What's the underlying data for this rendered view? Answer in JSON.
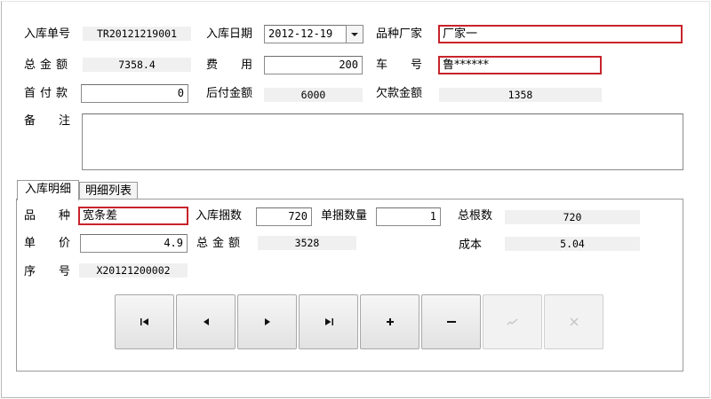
{
  "form": {
    "inbound_no": {
      "label": "入库单号",
      "value": "TR20121219001"
    },
    "inbound_date": {
      "label": "入库日期",
      "value": "2012-12-19"
    },
    "manufacturer": {
      "label": "品种厂家",
      "value": "厂家一"
    },
    "total_amount": {
      "label": "总金额",
      "value": "7358.4"
    },
    "fee": {
      "label": "费用",
      "value": "200"
    },
    "vehicle_no": {
      "label": "车号",
      "value": "鲁******"
    },
    "down_payment": {
      "label": "首付款",
      "value": "0"
    },
    "balance_payment": {
      "label": "后付金额",
      "value": "6000"
    },
    "arrears": {
      "label": "欠款金额",
      "value": "1358"
    },
    "remark": {
      "label": "备注",
      "value": ""
    }
  },
  "tabs": [
    {
      "label": "入库明细",
      "active": true
    },
    {
      "label": "明细列表",
      "active": false
    }
  ],
  "detail": {
    "variety": {
      "label": "品种",
      "value": "宽条差"
    },
    "bundles": {
      "label": "入库捆数",
      "value": "720"
    },
    "per_bundle": {
      "label": "单捆数量",
      "value": "1"
    },
    "total_roots": {
      "label": "总根数",
      "value": "720"
    },
    "unit_price": {
      "label": "单价",
      "value": "4.9"
    },
    "total_amount": {
      "label": "总金额",
      "value": "3528"
    },
    "cost": {
      "label": "成本",
      "value": "5.04"
    },
    "serial_no": {
      "label": "序号",
      "value": "X20121200002"
    }
  },
  "navigator": [
    {
      "name": "first-record-button",
      "icon": "first-icon",
      "glyph": "|◂",
      "enabled": true
    },
    {
      "name": "prior-record-button",
      "icon": "prior-icon",
      "glyph": "◂",
      "enabled": true
    },
    {
      "name": "next-record-button",
      "icon": "next-icon",
      "glyph": "▸",
      "enabled": true
    },
    {
      "name": "last-record-button",
      "icon": "last-icon",
      "glyph": "▸|",
      "enabled": true
    },
    {
      "name": "insert-record-button",
      "icon": "plus-icon",
      "glyph": "+",
      "enabled": true
    },
    {
      "name": "delete-record-button",
      "icon": "minus-icon",
      "glyph": "−",
      "enabled": true
    },
    {
      "name": "post-edit-button",
      "icon": "check-icon",
      "glyph": "✓",
      "enabled": false
    },
    {
      "name": "cancel-edit-button",
      "icon": "cancel-icon",
      "glyph": "✕",
      "enabled": false
    }
  ],
  "colors": {
    "error_border": "#c8232b",
    "readonly_bg": "#f0f0f0"
  }
}
